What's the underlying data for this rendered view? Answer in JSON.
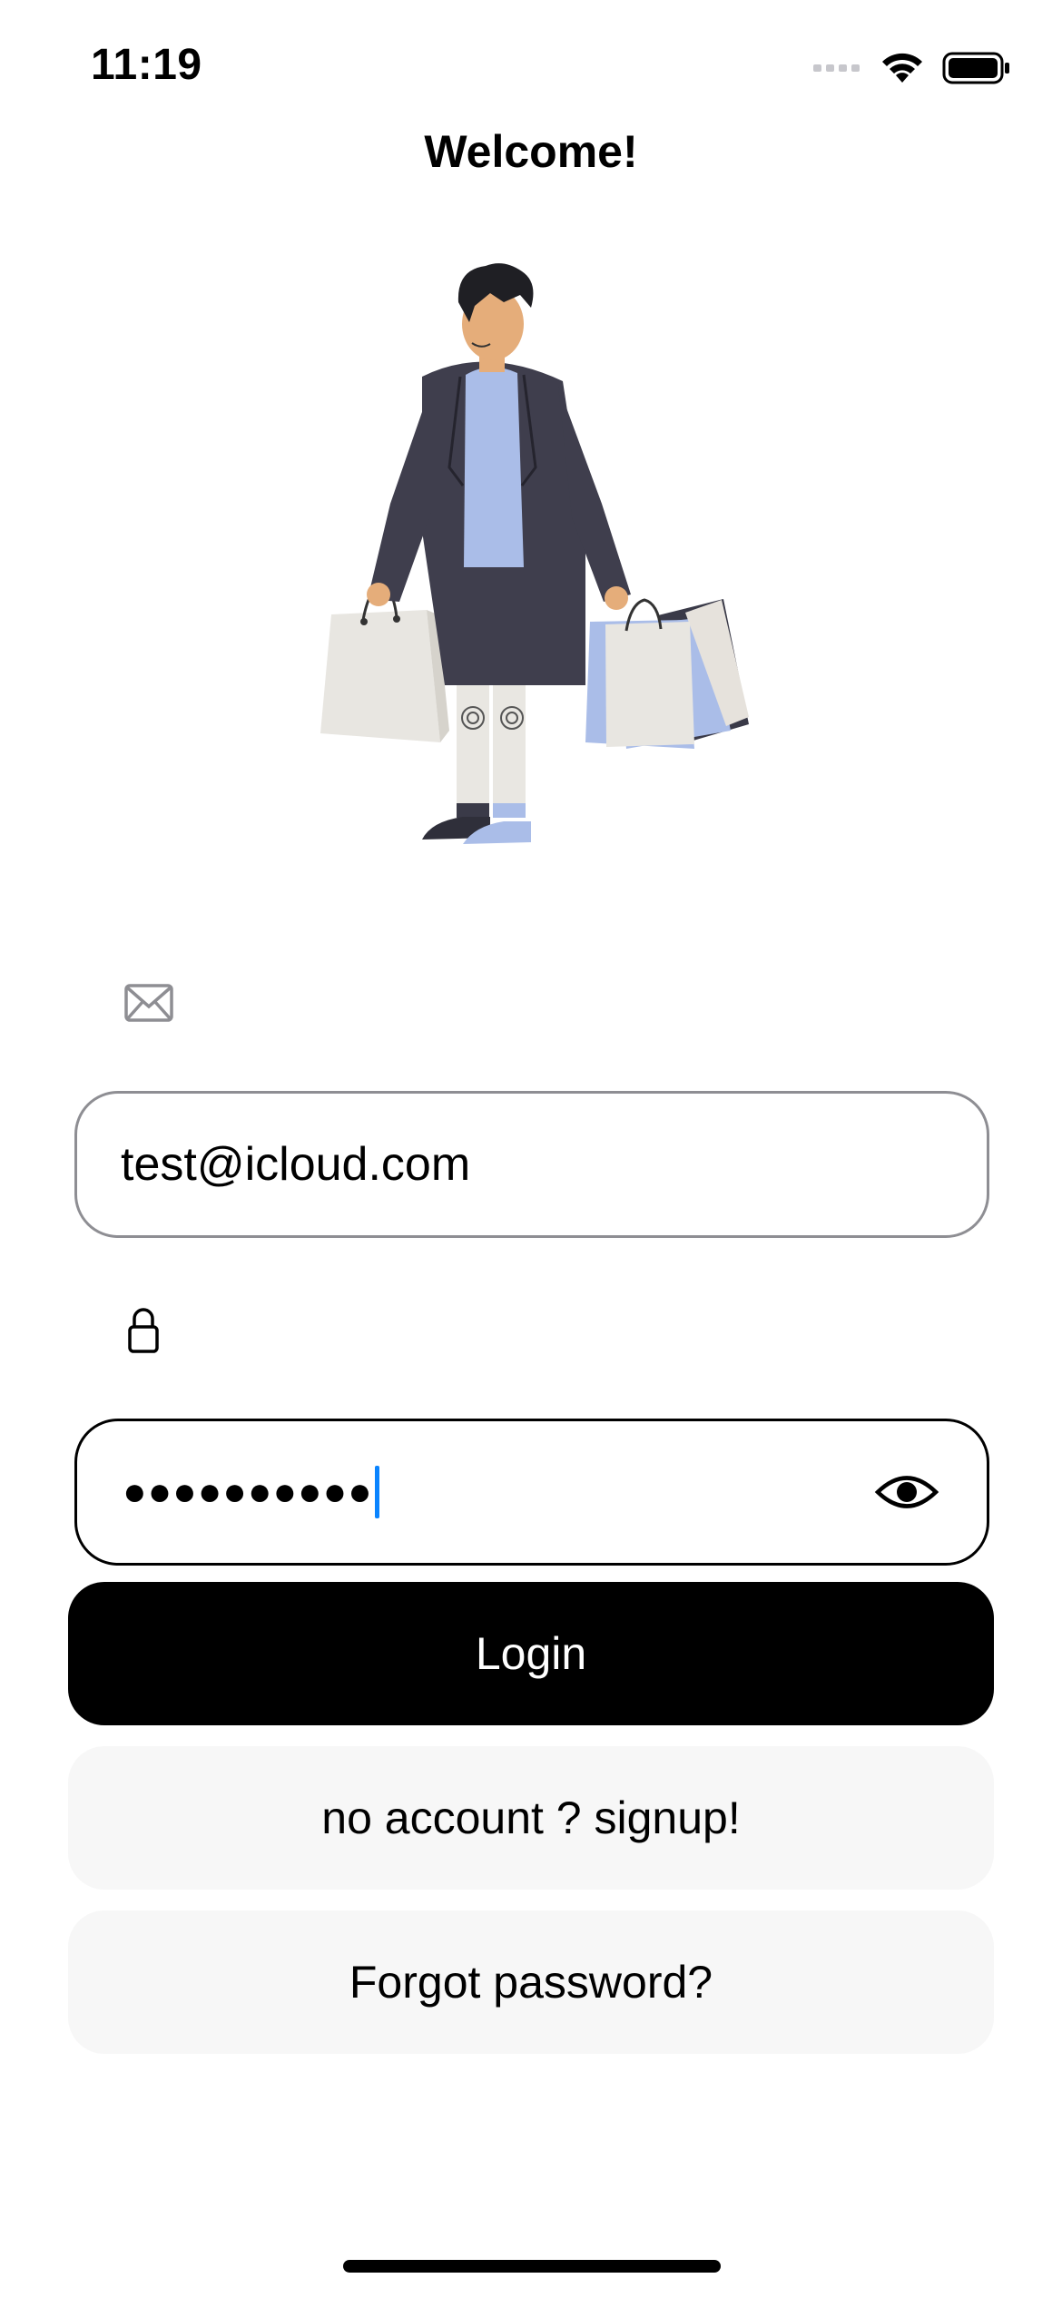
{
  "status_bar": {
    "time": "11:19",
    "icons": [
      "cellular-signal-icon",
      "wifi-icon",
      "battery-icon"
    ]
  },
  "header": {
    "title": "Welcome!"
  },
  "illustration": {
    "name": "shopping-man-illustration"
  },
  "email": {
    "icon": "envelope-icon",
    "value": "test@icloud.com"
  },
  "password": {
    "icon": "lock-icon",
    "masked_value": "●●●●●●●●●●",
    "visibility_icon": "eye-icon"
  },
  "buttons": {
    "login": "Login",
    "signup": "no account ? signup!",
    "forgot": "Forgot password?"
  },
  "colors": {
    "primary_button_bg": "#000000",
    "secondary_button_bg": "#f7f7f7",
    "caret": "#0a84ff",
    "email_border": "#8e8e93",
    "password_border": "#000000"
  }
}
